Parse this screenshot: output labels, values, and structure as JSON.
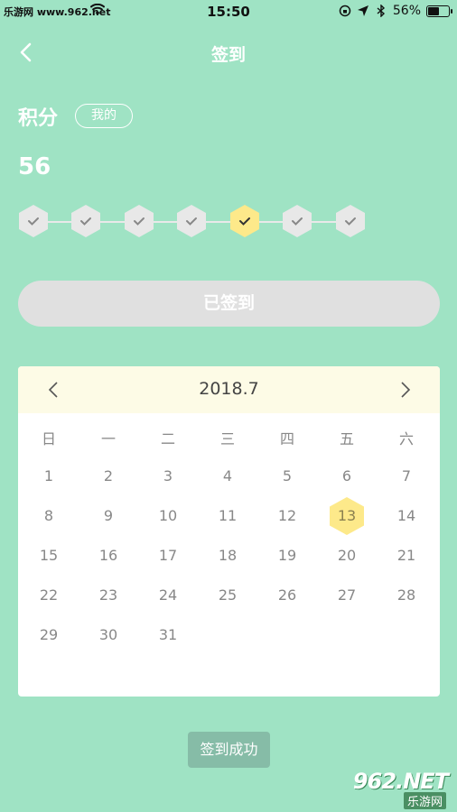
{
  "status_bar": {
    "carrier": "乐游网 www.962.net",
    "time": "15:50",
    "battery_percent": "56%",
    "battery_level": 0.56
  },
  "nav": {
    "title": "签到",
    "back_icon": "chevron-left-icon"
  },
  "points": {
    "label": "积分",
    "mine_button": "我的",
    "value": "56"
  },
  "week_progress": {
    "days": [
      {
        "state": "checked"
      },
      {
        "state": "checked"
      },
      {
        "state": "checked"
      },
      {
        "state": "checked"
      },
      {
        "state": "today"
      },
      {
        "state": "checked"
      },
      {
        "state": "checked"
      }
    ],
    "colors": {
      "checked": "#e8e8e8",
      "today": "#fde98a",
      "check": "#555555"
    }
  },
  "sign_button": {
    "label": "已签到"
  },
  "calendar": {
    "title": "2018.7",
    "weekdays": [
      "日",
      "一",
      "二",
      "三",
      "四",
      "五",
      "六"
    ],
    "start_weekday": 0,
    "days_in_month": 31,
    "selected_day": 13,
    "selected_color": "#fde98a"
  },
  "toast": {
    "text": "签到成功"
  },
  "watermark": {
    "big": "962.NET",
    "small": "乐游网"
  }
}
